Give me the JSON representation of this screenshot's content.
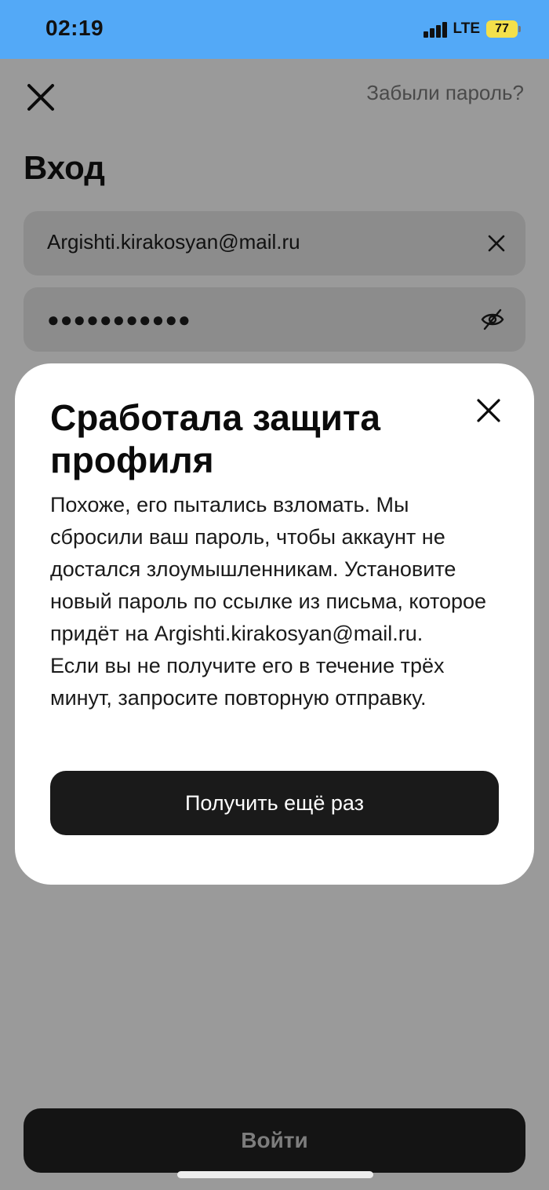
{
  "status_bar": {
    "time": "02:19",
    "network": "LTE",
    "battery": "77",
    "signal_icon": "signal-bars-icon",
    "battery_icon": "battery-charging-icon"
  },
  "login": {
    "forgot_password": "Забыли пароль?",
    "title": "Вход",
    "email_value": "Argishti.kirakosyan@mail.ru",
    "password_value": "●●●●●●●●●●●",
    "submit_label": "Войти",
    "close_icon": "close-icon",
    "clear_icon": "clear-icon",
    "visibility_icon": "eye-off-icon"
  },
  "modal": {
    "title": "Сработала защита профиля",
    "body_line_1": "Похоже, его пытались взломать. Мы сбросили ваш пароль, чтобы аккаунт не достался злоумышленникам. Установите новый пароль по ссылке из письма, которое придёт на Argishti.kirakosyan@mail.ru.",
    "body_line_2": "Если вы не получите его в течение трёх минут, запросите повторную отправку.",
    "resend_label": "Получить ещё раз",
    "close_icon": "close-icon"
  },
  "colors": {
    "status_bar": "#53a9f7",
    "overlay_background": "#9a9a9a",
    "modal_background": "#ffffff",
    "button_dark": "#1a1a1a",
    "battery_yellow": "#f4e04a"
  }
}
